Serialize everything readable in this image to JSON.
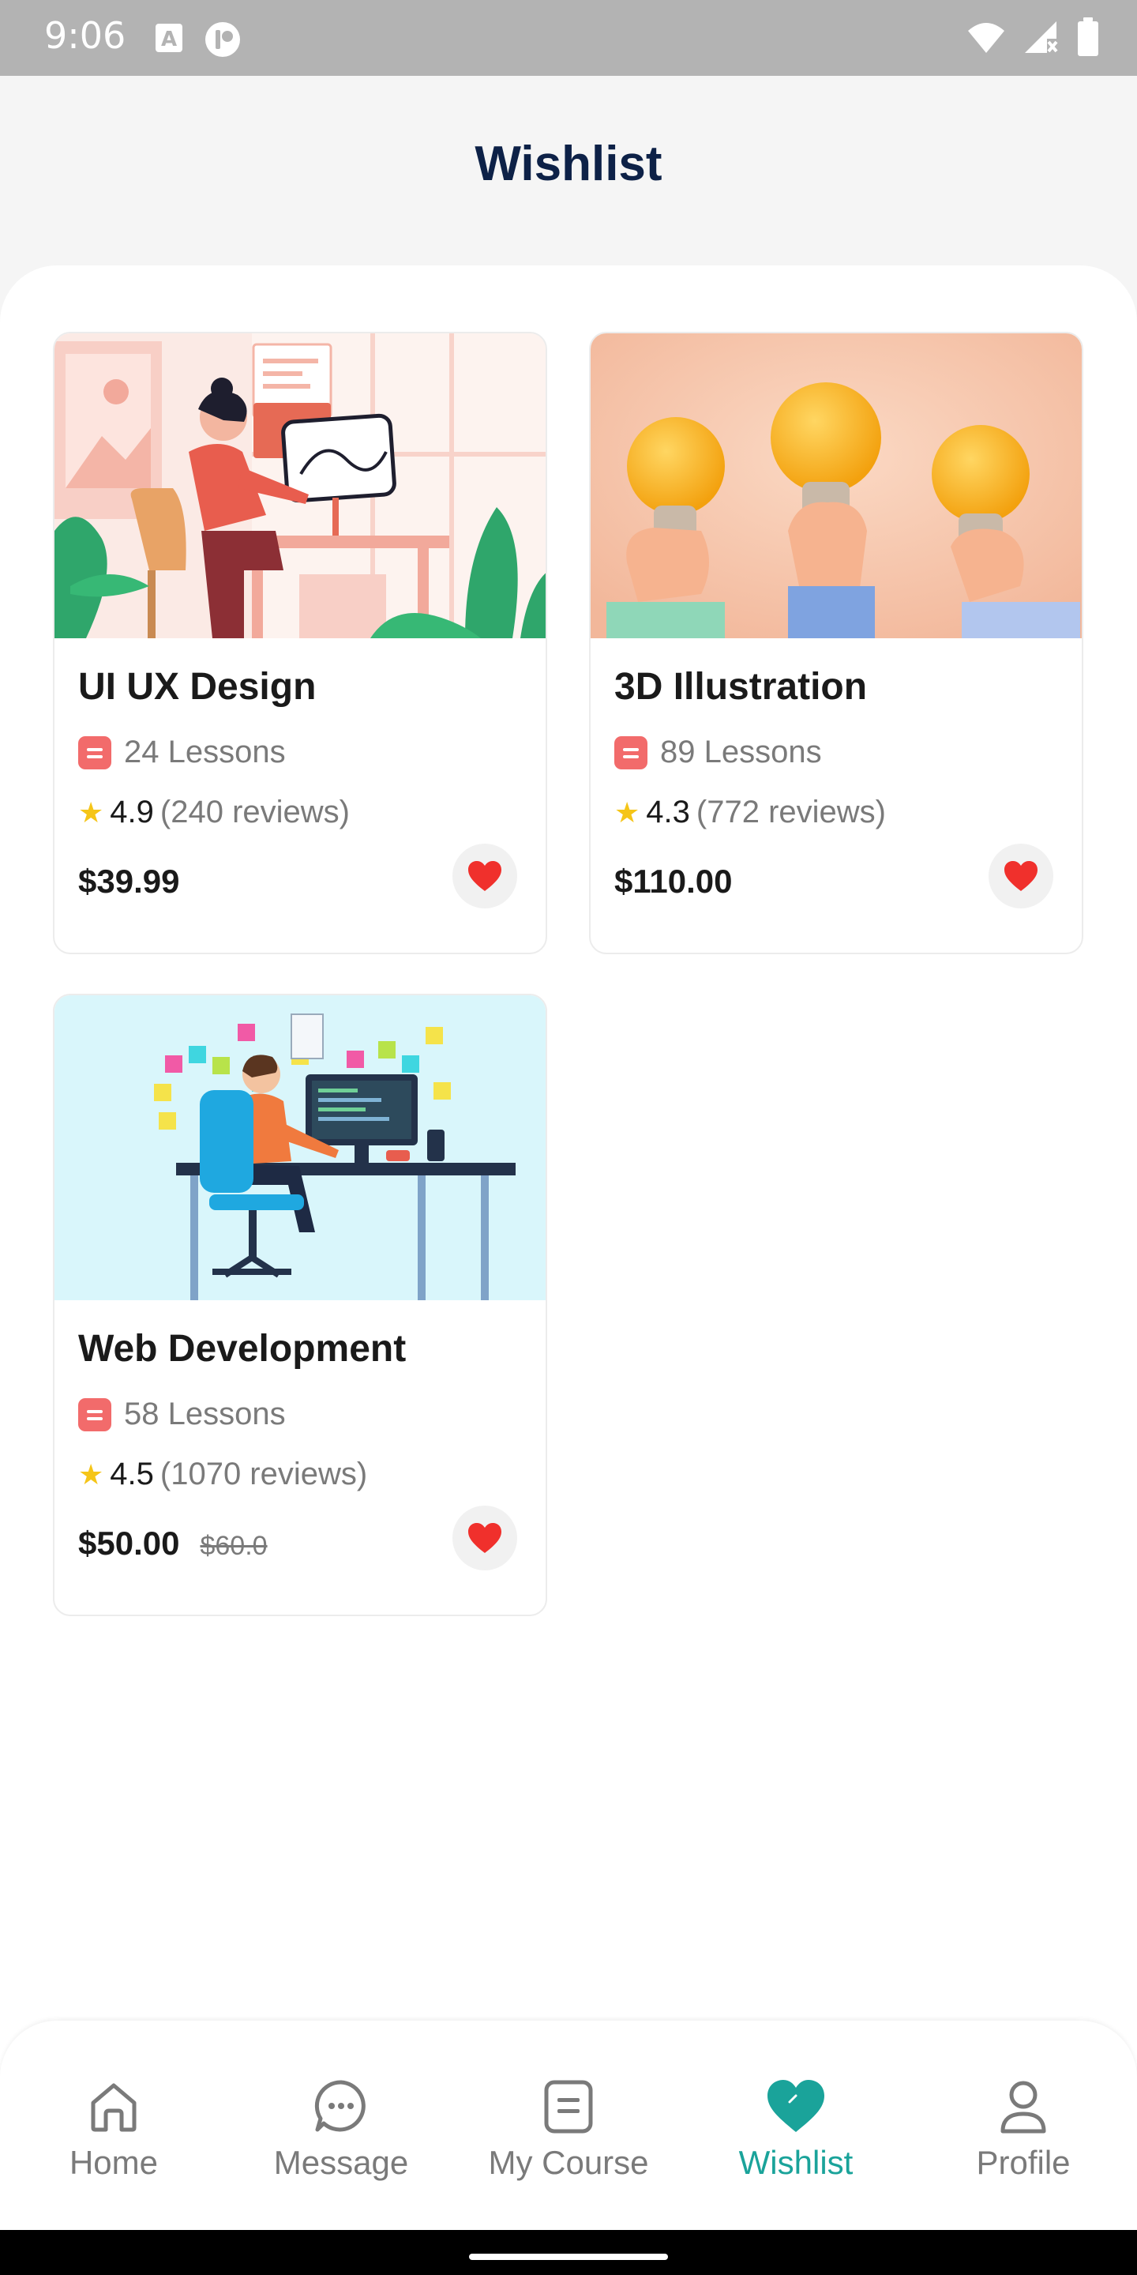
{
  "status_bar": {
    "time": "9:06",
    "left_icons": [
      "text-a-icon",
      "app-badge-icon"
    ],
    "right_icons": [
      "wifi-icon",
      "signal-no-service-icon",
      "battery-icon"
    ]
  },
  "header": {
    "title": "Wishlist"
  },
  "courses": [
    {
      "title": "UI UX Design",
      "lessons": "24 Lessons",
      "rating": "4.9",
      "reviews": "(240 reviews)",
      "price": "$39.99",
      "old_price": "",
      "image": "ui-ux-design-illustration"
    },
    {
      "title": "3D Illustration",
      "lessons": "89 Lessons",
      "rating": "4.3",
      "reviews": "(772 reviews)",
      "price": "$110.00",
      "old_price": "",
      "image": "lightbulb-hands-illustration"
    },
    {
      "title": "Web Development",
      "lessons": "58 Lessons",
      "rating": "4.5",
      "reviews": "(1070 reviews)",
      "price": "$50.00",
      "old_price": "$60.0",
      "image": "web-developer-desk-illustration"
    }
  ],
  "nav": [
    {
      "label": "Home",
      "icon": "home-icon",
      "active": false
    },
    {
      "label": "Message",
      "icon": "message-icon",
      "active": false
    },
    {
      "label": "My Course",
      "icon": "course-icon",
      "active": false
    },
    {
      "label": "Wishlist",
      "icon": "heart-icon",
      "active": true
    },
    {
      "label": "Profile",
      "icon": "profile-icon",
      "active": false
    }
  ],
  "colors": {
    "accent": "#1aa39a",
    "title": "#0d2147",
    "heart": "#f0302c",
    "lesson_icon": "#f26b6b",
    "star": "#f5c518"
  }
}
